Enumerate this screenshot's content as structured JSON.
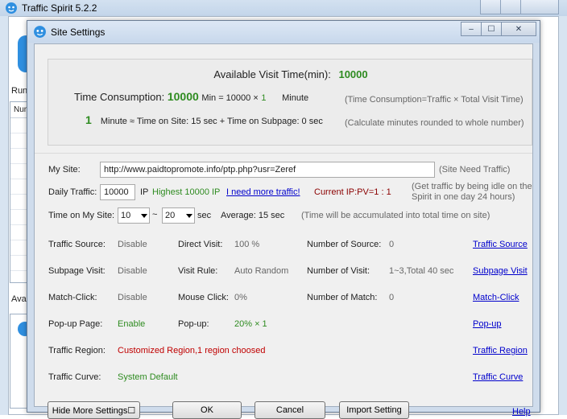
{
  "main_window": {
    "title": "Traffic Spirit 5.2.2",
    "run_label": "Runi",
    "list_header": "Num",
    "avail_label": "Avai"
  },
  "dialog": {
    "title": "Site Settings",
    "titlebar_buttons": {
      "minimize": "–",
      "maximize": "☐",
      "close": "✕"
    }
  },
  "info": {
    "available_label": "Available Visit Time(min):",
    "available_value": "10000",
    "time_consumption_label": "Time Consumption:",
    "time_consumption_value": "10000",
    "min_equation": "Min = 10000 ×",
    "multiplier": "1",
    "minute_label": "Minute",
    "tc_note": "(Time Consumption=Traffic × Total Visit Time)",
    "minutes_value": "1",
    "minutes_formula": "Minute ≈ Time on Site: 15 sec + Time on Subpage: 0 sec",
    "minutes_note": "(Calculate minutes rounded to whole number)"
  },
  "site": {
    "my_site_label": "My Site:",
    "my_site_value": "http://www.paidtopromote.info/ptp.php?usr=Zeref",
    "my_site_note": "(Site Need Traffic)",
    "daily_traffic_label": "Daily Traffic:",
    "daily_traffic_value": "10000",
    "ip_label": "IP",
    "highest_ip": "Highest 10000 IP",
    "need_more_link": "I need more traffic!",
    "current_ip": "Current IP:PV=1 : 1",
    "idle_note_1": "(Get traffic by being idle on the",
    "idle_note_2": "Spirit in one day 24 hours)",
    "time_on_site_label": "Time on My Site:",
    "time_from": "10",
    "tilde": "~",
    "time_to": "20",
    "sec_label": "sec",
    "average": "Average: 15 sec",
    "time_note": "(Time will be accumulated into total time on site)"
  },
  "settings": {
    "traffic_source_label": "Traffic Source:",
    "traffic_source_value": "Disable",
    "direct_visit_label": "Direct Visit:",
    "direct_visit_value": "100 %",
    "number_of_source_label": "Number of Source:",
    "number_of_source_value": "0",
    "traffic_source_link": "Traffic Source",
    "subpage_visit_label": "Subpage Visit:",
    "subpage_visit_value": "Disable",
    "visit_rule_label": "Visit Rule:",
    "visit_rule_value": "Auto Random",
    "number_of_visit_label": "Number of Visit:",
    "number_of_visit_value": "1~3,Total 40 sec",
    "subpage_visit_link": "Subpage Visit",
    "match_click_label": "Match-Click:",
    "match_click_value": "Disable",
    "mouse_click_label": "Mouse Click:",
    "mouse_click_value": "0%",
    "number_of_match_label": "Number of Match:",
    "number_of_match_value": "0",
    "match_click_link": "Match-Click",
    "popup_page_label": "Pop-up Page:",
    "popup_page_value": "Enable",
    "popup_label": "Pop-up:",
    "popup_value": "20% × 1",
    "popup_link": "Pop-up",
    "traffic_region_label": "Traffic Region:",
    "traffic_region_value": "Customized Region,1 region choosed",
    "traffic_region_link": "Traffic Region",
    "traffic_curve_label": "Traffic Curve:",
    "traffic_curve_value": "System Default",
    "traffic_curve_link": "Traffic Curve"
  },
  "buttons": {
    "hide_more": "Hide More Settings☐",
    "ok": "OK",
    "cancel": "Cancel",
    "import": "Import Setting",
    "help": "Help"
  },
  "colors": {
    "green_value": "#2e8b20",
    "red_value": "#c00000",
    "link": "#0000cc"
  }
}
